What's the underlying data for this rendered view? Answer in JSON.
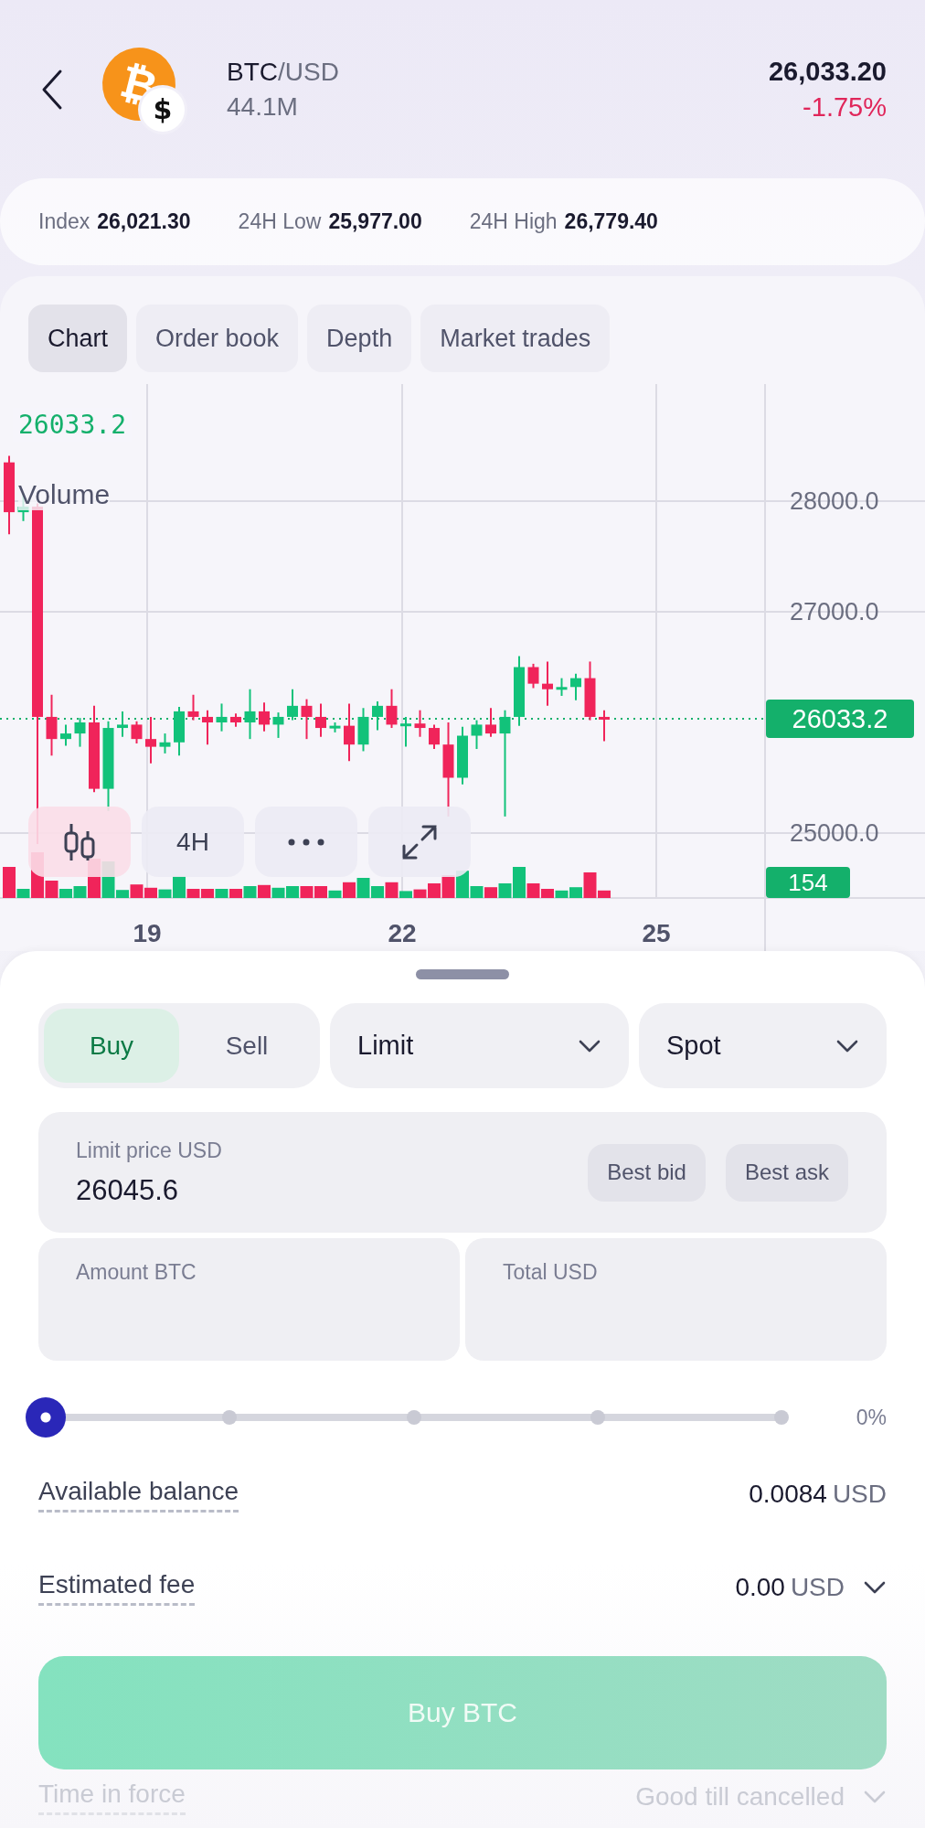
{
  "header": {
    "base_symbol": "₿",
    "quote_symbol": "$",
    "pair_base": "BTC",
    "pair_quote": "/USD",
    "volume": "44.1M",
    "price": "26,033.20",
    "change": "-1.75%"
  },
  "stats": [
    {
      "label": "Index",
      "value": "26,021.30"
    },
    {
      "label": "24H Low",
      "value": "25,977.00"
    },
    {
      "label": "24H High",
      "value": "26,779.40"
    }
  ],
  "tabs": [
    {
      "label": "Chart",
      "selected": true
    },
    {
      "label": "Order book",
      "selected": false
    },
    {
      "label": "Depth",
      "selected": false
    },
    {
      "label": "Market trades",
      "selected": false
    }
  ],
  "chart": {
    "last_price": "26033.2",
    "indicator": "Volume",
    "y_labels": [
      "28000.0",
      "27000.0",
      "25000.0"
    ],
    "price_tag": "26033.2",
    "volume_tag": "154",
    "x_labels": [
      "19",
      "22",
      "25"
    ],
    "tools": [
      {
        "kind": "candles",
        "selected": true
      },
      {
        "kind": "text",
        "label": "4H",
        "selected": false
      },
      {
        "kind": "more",
        "selected": false
      },
      {
        "kind": "expand",
        "selected": false
      }
    ]
  },
  "order": {
    "sides": [
      {
        "label": "Buy",
        "selected": true
      },
      {
        "label": "Sell",
        "selected": false
      }
    ],
    "order_type": "Limit",
    "market": "Spot",
    "limit_price": {
      "label": "Limit price USD",
      "value": "26045.6"
    },
    "quick_buttons": [
      "Best bid",
      "Best ask"
    ],
    "amount": {
      "label": "Amount BTC"
    },
    "total": {
      "label": "Total USD"
    },
    "slider": {
      "level": 0,
      "reading": "0%"
    },
    "rows": [
      {
        "label": "Available balance",
        "value": "0.0084",
        "unit": "USD",
        "expandable": false,
        "dimmed": false
      },
      {
        "label": "Estimated fee",
        "value": "0.00",
        "unit": "USD",
        "expandable": true,
        "dimmed": false
      }
    ],
    "submit": {
      "label": "Buy BTC",
      "disabled": true
    },
    "after_rows": [
      {
        "label": "Time in force",
        "value": "Good till cancelled",
        "expandable": true,
        "dimmed": true
      }
    ]
  }
}
